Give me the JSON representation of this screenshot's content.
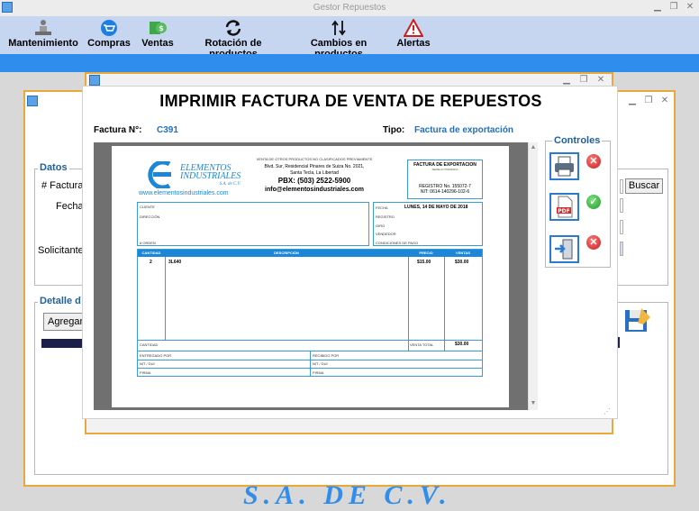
{
  "window": {
    "title": "Gestor Repuestos"
  },
  "menu": [
    {
      "label": "Mantenimiento",
      "icon": "maintenance-icon"
    },
    {
      "label": "Compras",
      "icon": "cart-icon"
    },
    {
      "label": "Ventas",
      "icon": "money-icon"
    },
    {
      "label": "Rotación de productos",
      "icon": "rotate-icon"
    },
    {
      "label": "Cambios en productos",
      "icon": "swap-arrows-icon"
    },
    {
      "label": "Alertas",
      "icon": "warning-icon"
    }
  ],
  "bg_form": {
    "datos_title": "Datos",
    "factura_label": "# Factura:",
    "fecha_label": "Fecha:",
    "solicitante_label": "Solicitante:",
    "buscar_button": "Buscar",
    "detalle_title": "Detalle d",
    "agregar_button": "Agregar d",
    "watermark": "S.A. DE C.V."
  },
  "dialog": {
    "title": "IMPRIMIR FACTURA DE VENTA DE REPUESTOS",
    "factura_label": "Factura N°:",
    "factura_value": "C391",
    "tipo_label": "Tipo:",
    "tipo_value": "Factura de exportación",
    "controls_title": "Controles"
  },
  "invoice": {
    "company_line1": "ELEMENTOS",
    "company_line2": "INDUSTRIALES",
    "company_suffix": "S.A. de C.V.",
    "website": "www.elementosindustriales.com",
    "header_line1": "VENTA DE OTROS PRODUCTOS NO CLASIFICADOS PREVIAMENTE",
    "header_line2": "Blvd. Sur, Residencial Pinares de Suiza No. 2021,",
    "header_line3": "Santa Tecla, La Libertad",
    "phone": "PBX: (503) 2522-5900",
    "email": "info@elementosindustriales.com",
    "doc_title": "FACTURA DE EXPORTACION",
    "doc_sub": "SERIE AUTORIZADA",
    "registro": "REGISTRO No. 155072-7",
    "nit": "NIT: 0614-140296-102-6",
    "cliente": "CLIENTE",
    "direccion": "DIRECCIÓN",
    "orden": "# ORDEN",
    "fecha": "FECHA",
    "fecha_value": "LUNES, 14 DE MAYO DE 2018",
    "registro_lbl": "REGISTRO",
    "giro": "GIRO",
    "vendedor": "VENDEDOR",
    "condiciones": "CONDICIONES DE PAGO",
    "col_cantidad": "CANTIDAD",
    "col_descripcion": "DESCRIPCIÓN",
    "col_precio": "PRECIO",
    "col_ventas": "VENTAS",
    "row_qty": "2",
    "row_desc": "3L640",
    "row_price": "$15.00",
    "row_total": "$30.00",
    "cantidad_footer": "CANTIDAD",
    "venta_total": "VENTA TOTAL",
    "venta_total_value": "$30.00",
    "entregado": "ENTREGADO POR",
    "recibido": "RECIBIDO POR",
    "nit_dui_1": "NIT / DUI",
    "nit_dui_2": "NIT / DUI",
    "firma_1": "FIRMA",
    "firma_2": "FIRMA"
  },
  "controls": [
    {
      "icon": "printer-icon",
      "status": "disabled"
    },
    {
      "icon": "pdf-icon",
      "status": "enabled"
    },
    {
      "icon": "exit-icon",
      "status": "disabled"
    }
  ],
  "colors": {
    "accent": "#2f8ded",
    "menu_bg": "#c6d6f1",
    "frame": "#e9a93a",
    "link": "#1f6fc2"
  }
}
